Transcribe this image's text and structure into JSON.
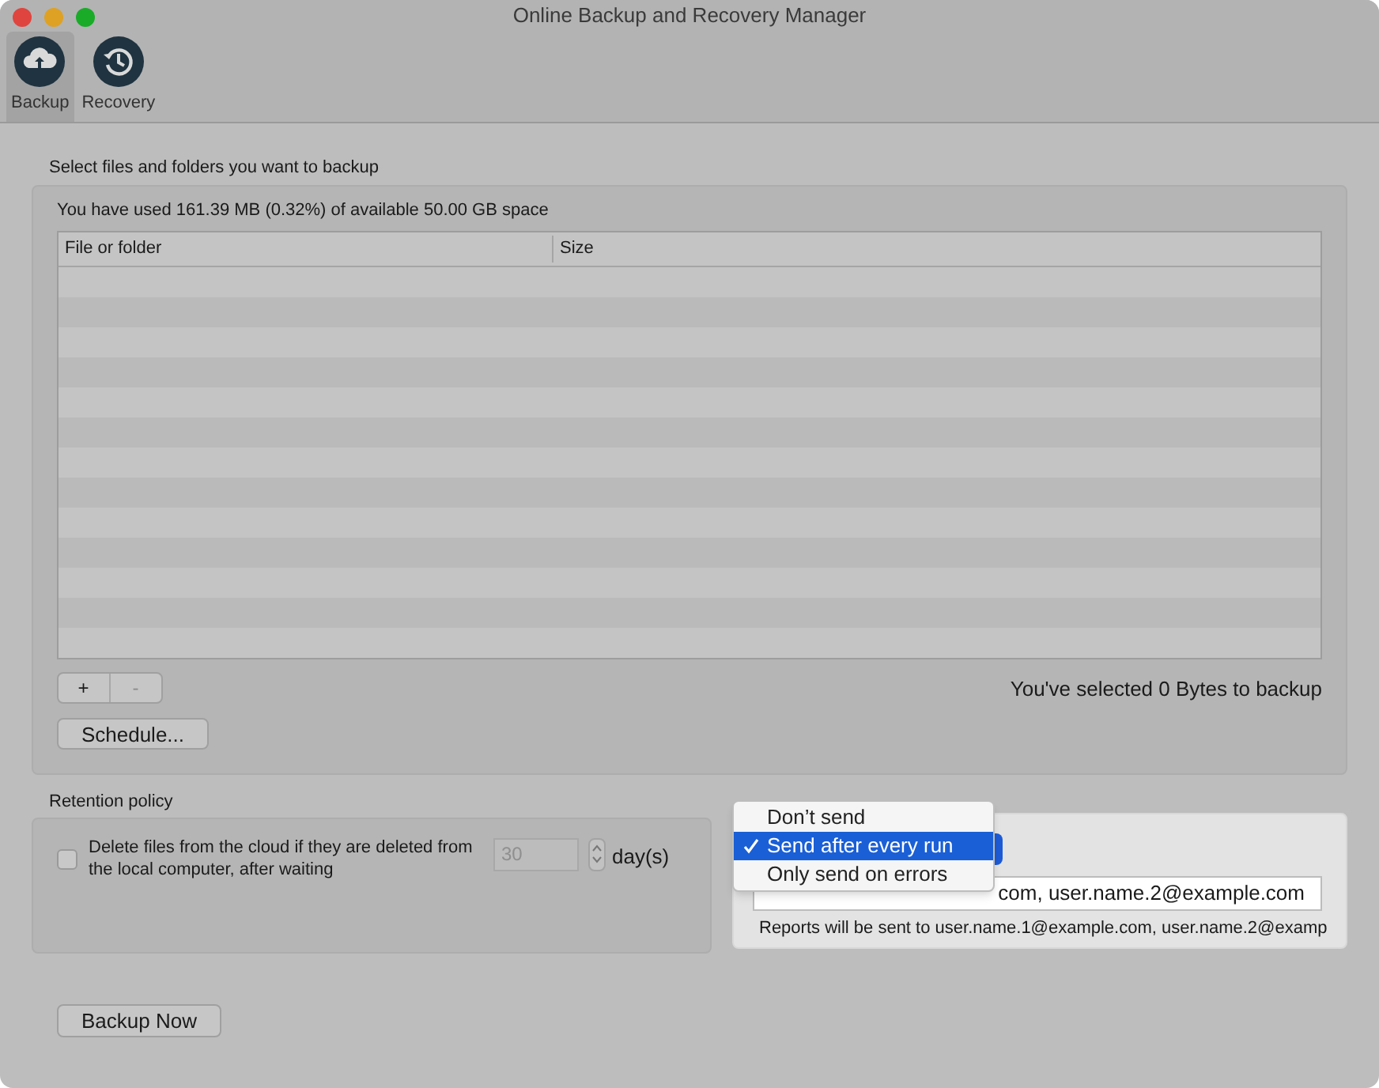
{
  "window": {
    "title": "Online Backup and Recovery Manager"
  },
  "toolbar": [
    {
      "label": "Backup",
      "kind": "cloud",
      "selected": true
    },
    {
      "label": "Recovery",
      "kind": "history",
      "selected": false
    }
  ],
  "files_section": {
    "title": "Select files and folders you want to backup",
    "usage": "You have used 161.39 MB (0.32%) of available 50.00 GB space",
    "table": {
      "columns": [
        "File or folder",
        "Size"
      ]
    },
    "add_button": "+",
    "remove_button": "-",
    "selected_summary": "You've selected 0 Bytes to backup",
    "schedule_button": "Schedule..."
  },
  "retention": {
    "title": "Retention policy",
    "checked": false,
    "label": "Delete files from the cloud if they are deleted from the local computer, after waiting",
    "days": "30",
    "unit": "day(s)"
  },
  "email": {
    "menu": [
      {
        "label": "Don’t send",
        "selected": false
      },
      {
        "label": "Send after every run",
        "selected": true
      },
      {
        "label": "Only send on errors",
        "selected": false
      }
    ],
    "recipients": "com, user.name.2@example.com",
    "note": "Reports will be sent to user.name.1@example.com, user.name.2@examp"
  },
  "backup_now_button": "Backup Now"
}
